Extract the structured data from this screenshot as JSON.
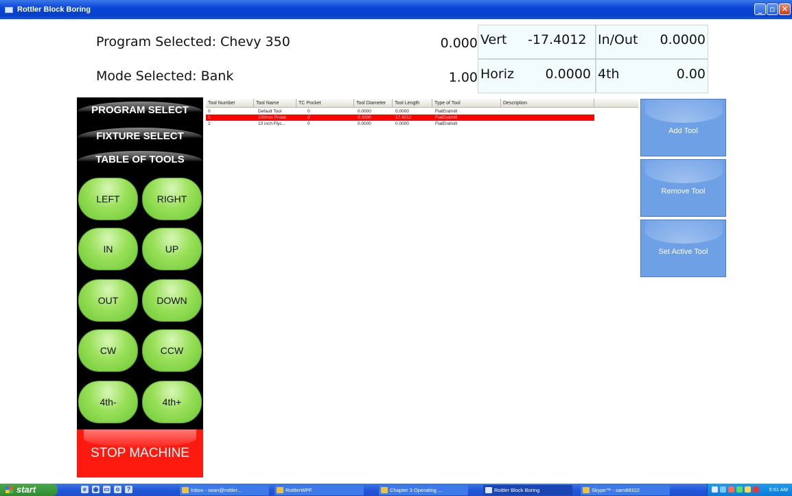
{
  "window": {
    "title": "Rottler Block Boring"
  },
  "header": {
    "program_label": "Program Selected: Chevy 350",
    "mode_label": "Mode Selected: Bank",
    "row1_num": "0.000",
    "row2_num": "1.00",
    "vert_label": "Vert",
    "vert_value": "-17.4012",
    "inout_label": "In/Out",
    "inout_value": "0.0000",
    "horiz_label": "Horiz",
    "horiz_value": "0.0000",
    "fourth_label": "4th",
    "fourth_value": "0.00"
  },
  "nav": {
    "program_select": "PROGRAM SELECT",
    "fixture_select": "FIXTURE SELECT",
    "table_of_tools": "TABLE OF TOOLS"
  },
  "jog": {
    "left": "LEFT",
    "right": "RIGHT",
    "in": "IN",
    "up": "UP",
    "out": "OUT",
    "down": "DOWN",
    "cw": "CW",
    "ccw": "CCW",
    "fourth_minus": "4th-",
    "fourth_plus": "4th+"
  },
  "stop_label": "STOP MACHINE",
  "tools_table": {
    "columns": [
      "Tool Number",
      "Tool Name",
      "TC Pocket",
      "Tool Diameter",
      "Tool Length",
      "Type of Tool",
      "Description"
    ],
    "rows": [
      [
        "0",
        "Default Tool",
        "0",
        "0.0000",
        "0.0000",
        "FlatEndmill",
        ""
      ],
      [
        "1",
        "100mm Probe",
        "0",
        "0.2000",
        "17.4012",
        "FlatEndmill",
        ""
      ],
      [
        "2",
        "10 inch Flyc...",
        "0",
        "0.0000",
        "0.0000",
        "FlatEndmill",
        ""
      ]
    ],
    "selected_row": 1
  },
  "actions": {
    "add_tool": "Add Tool",
    "remove_tool": "Remove Tool",
    "set_active_tool": "Set Active Tool"
  },
  "taskbar": {
    "start": "start",
    "tasks": [
      "Inbox - sean@rottler...",
      "RottlerWPF",
      "Chapter 3 Operating ...",
      "Rottler Block Boring",
      "Skype™ - sam88322"
    ],
    "active_task": 3,
    "clock": "5:51 AM"
  },
  "colors": {
    "titlebar": "#0a46d8",
    "jog_button": "#8edc50",
    "stop": "#ff1a10",
    "selected_row": "#ff0000",
    "action_button": "#6ea0e6",
    "readout_cell": "#f2fcfc"
  }
}
